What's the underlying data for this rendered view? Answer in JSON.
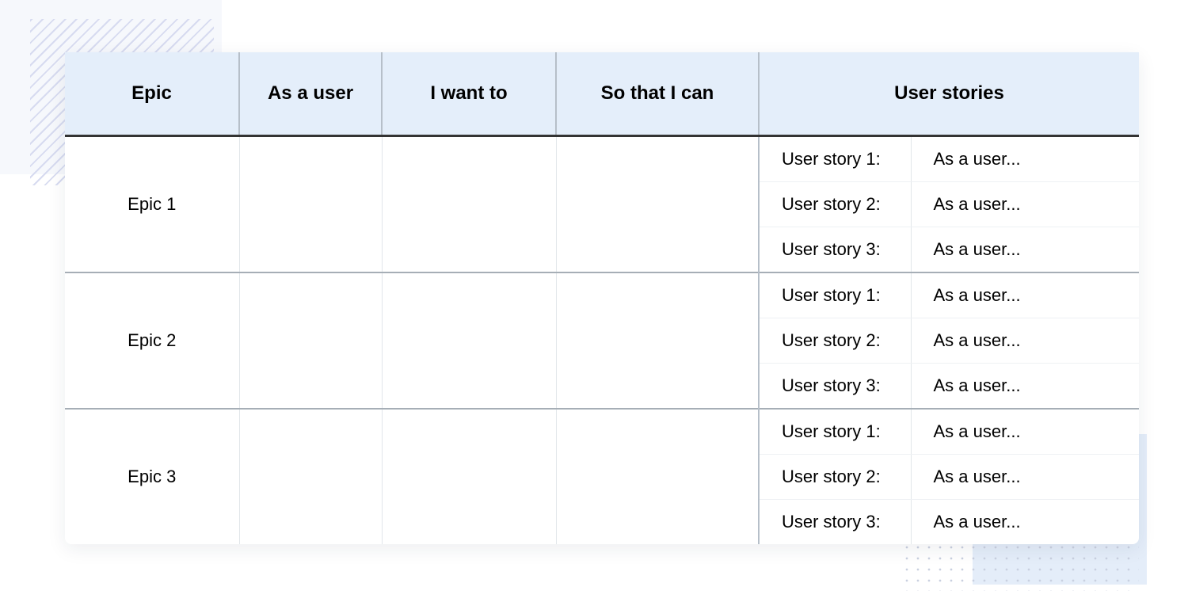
{
  "columns": {
    "epic": "Epic",
    "as_a_user": "As a user",
    "i_want_to": "I want to",
    "so_that_i_can": "So that I can",
    "user_stories": "User stories"
  },
  "rows": [
    {
      "epic": "Epic 1",
      "as_a_user": "",
      "i_want_to": "",
      "so_that_i_can": "",
      "stories": [
        {
          "label": "User story 1:",
          "text": "As a user..."
        },
        {
          "label": "User story 2:",
          "text": "As a user..."
        },
        {
          "label": "User story 3:",
          "text": "As a user..."
        }
      ]
    },
    {
      "epic": "Epic 2",
      "as_a_user": "",
      "i_want_to": "",
      "so_that_i_can": "",
      "stories": [
        {
          "label": "User story 1:",
          "text": "As a user..."
        },
        {
          "label": "User story 2:",
          "text": "As a user..."
        },
        {
          "label": "User story 3:",
          "text": "As a user..."
        }
      ]
    },
    {
      "epic": "Epic 3",
      "as_a_user": "",
      "i_want_to": "",
      "so_that_i_can": "",
      "stories": [
        {
          "label": "User story 1:",
          "text": "As a user..."
        },
        {
          "label": "User story 2:",
          "text": "As a user..."
        },
        {
          "label": "User story 3:",
          "text": "As a user..."
        }
      ]
    }
  ]
}
